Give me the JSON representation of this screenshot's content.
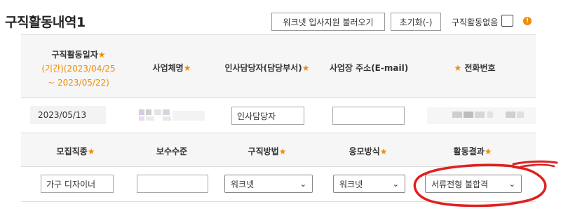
{
  "section": {
    "title": "구직활동내역1"
  },
  "toolbar": {
    "import_label": "워크넷 입사지원 불러오기",
    "reset_label": "초기화(-)",
    "no_history_label": "구직활동없음",
    "info_icon": "exclamation-circle-icon",
    "accent_color": "#f08c00"
  },
  "table1": {
    "headers": {
      "date": "구직활동일자",
      "date_range_line1": "(기간)(2023/04/25",
      "date_range_line2": "~ 2023/05/22)",
      "company": "사업체명",
      "hr_contact": "인사담당자(담당부서)",
      "email": "사업장 주소(E-mail)",
      "phone": "전화번호"
    },
    "row": {
      "date": "2023/05/13",
      "hr_contact_value": "인사담당자",
      "email_value": ""
    }
  },
  "table2": {
    "headers": {
      "job_type": "모집직종",
      "salary": "보수수준",
      "method": "구직방법",
      "apply_method": "응모방식",
      "result": "활동결과"
    },
    "row": {
      "job_type_value": "가구 디자이너",
      "salary_value": "",
      "method_selected": "워크넷",
      "apply_method_selected": "워크넷",
      "result_selected": "서류전형 불합격"
    }
  },
  "required_mark": "★",
  "annotation_color": "#e02020"
}
